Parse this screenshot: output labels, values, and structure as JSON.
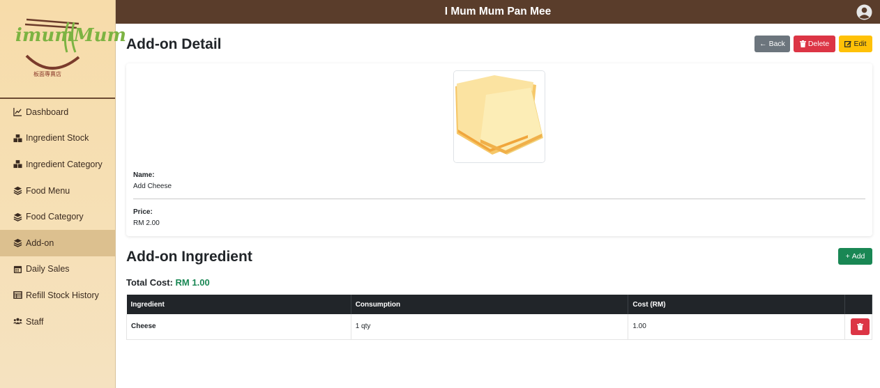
{
  "app": {
    "title": "I Mum Mum Pan Mee"
  },
  "brand": {
    "logo_text": "imumMum",
    "logo_sub": "板面專賣店",
    "colors": {
      "primary": "#5a3d2b",
      "accent_green": "#7cb342"
    }
  },
  "sidebar": {
    "items": [
      {
        "label": "Dashboard",
        "icon": "chart-line-icon"
      },
      {
        "label": "Ingredient Stock",
        "icon": "boxes-icon"
      },
      {
        "label": "Ingredient Category",
        "icon": "boxes-icon"
      },
      {
        "label": "Food Menu",
        "icon": "layers-icon"
      },
      {
        "label": "Food Category",
        "icon": "layers-icon"
      },
      {
        "label": "Add-on",
        "icon": "layers-icon",
        "active": true
      },
      {
        "label": "Daily Sales",
        "icon": "calendar-icon"
      },
      {
        "label": "Refill Stock History",
        "icon": "table-icon"
      },
      {
        "label": "Staff",
        "icon": "users-icon"
      }
    ]
  },
  "page": {
    "title": "Add-on Detail",
    "buttons": {
      "back": "Back",
      "delete": "Delete",
      "edit": "Edit"
    }
  },
  "detail": {
    "name_label": "Name:",
    "name_value": "Add Cheese",
    "price_label": "Price:",
    "price_value": "RM 2.00",
    "image_alt": "cheese slices"
  },
  "ingredients": {
    "title": "Add-on Ingredient",
    "add_label": "Add",
    "total_label": "Total Cost:",
    "total_value": "RM 1.00",
    "columns": [
      "Ingredient",
      "Consumption",
      "Cost (RM)",
      ""
    ],
    "rows": [
      {
        "ingredient": "Cheese",
        "consumption": "1 qty",
        "cost": "1.00"
      }
    ]
  }
}
